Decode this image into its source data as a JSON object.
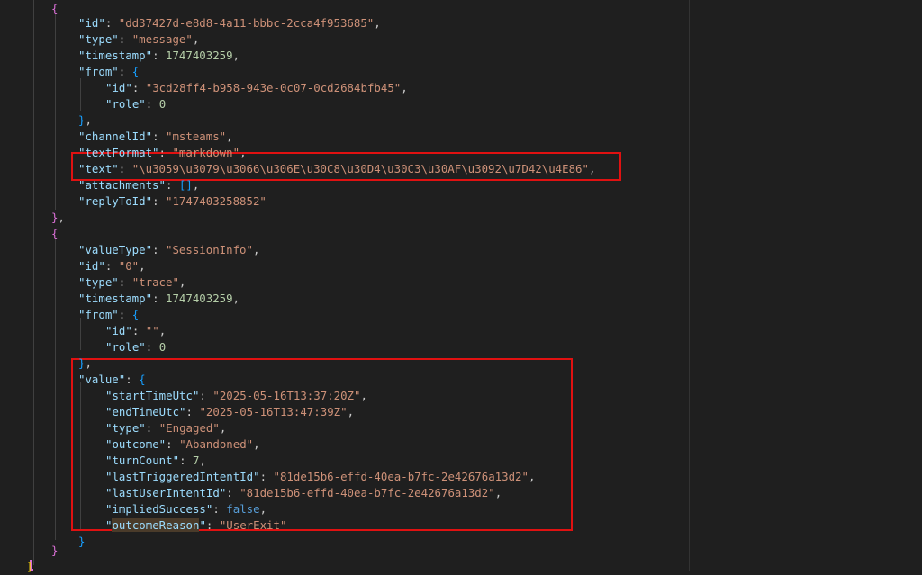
{
  "lines": [
    [
      {
        "t": "b2",
        "v": "{"
      }
    ],
    [
      {
        "t": "k",
        "v": "\"id\""
      },
      {
        "t": "p",
        "v": ": "
      },
      {
        "t": "s",
        "v": "\"dd37427d-e8d8-4a11-bbbc-2cca4f953685\""
      },
      {
        "t": "p",
        "v": ","
      }
    ],
    [
      {
        "t": "k",
        "v": "\"type\""
      },
      {
        "t": "p",
        "v": ": "
      },
      {
        "t": "s",
        "v": "\"message\""
      },
      {
        "t": "p",
        "v": ","
      }
    ],
    [
      {
        "t": "k",
        "v": "\"timestamp\""
      },
      {
        "t": "p",
        "v": ": "
      },
      {
        "t": "n",
        "v": "1747403259"
      },
      {
        "t": "p",
        "v": ","
      }
    ],
    [
      {
        "t": "k",
        "v": "\"from\""
      },
      {
        "t": "p",
        "v": ": "
      },
      {
        "t": "b3",
        "v": "{"
      }
    ],
    [
      {
        "t": "k",
        "v": "\"id\""
      },
      {
        "t": "p",
        "v": ": "
      },
      {
        "t": "s",
        "v": "\"3cd28ff4-b958-943e-0c07-0cd2684bfb45\""
      },
      {
        "t": "p",
        "v": ","
      }
    ],
    [
      {
        "t": "k",
        "v": "\"role\""
      },
      {
        "t": "p",
        "v": ": "
      },
      {
        "t": "n",
        "v": "0"
      }
    ],
    [
      {
        "t": "b3",
        "v": "}"
      },
      {
        "t": "p",
        "v": ","
      }
    ],
    [
      {
        "t": "k",
        "v": "\"channelId\""
      },
      {
        "t": "p",
        "v": ": "
      },
      {
        "t": "s",
        "v": "\"msteams\""
      },
      {
        "t": "p",
        "v": ","
      }
    ],
    [
      {
        "t": "k",
        "v": "\"textFormat\""
      },
      {
        "t": "p",
        "v": ": "
      },
      {
        "t": "s",
        "v": "\"markdown\""
      },
      {
        "t": "p",
        "v": ","
      }
    ],
    [
      {
        "t": "k",
        "v": "\"text\""
      },
      {
        "t": "p",
        "v": ": "
      },
      {
        "t": "s",
        "v": "\"\\u3059\\u3079\\u3066\\u306E\\u30C8\\u30D4\\u30C3\\u30AF\\u3092\\u7D42\\u4E86\""
      },
      {
        "t": "p",
        "v": ","
      }
    ],
    [
      {
        "t": "k",
        "v": "\"attachments\""
      },
      {
        "t": "p",
        "v": ": "
      },
      {
        "t": "b3",
        "v": "[]"
      },
      {
        "t": "p",
        "v": ","
      }
    ],
    [
      {
        "t": "k",
        "v": "\"replyToId\""
      },
      {
        "t": "p",
        "v": ": "
      },
      {
        "t": "s",
        "v": "\"1747403258852\""
      }
    ],
    [
      {
        "t": "b2",
        "v": "}"
      },
      {
        "t": "p",
        "v": ","
      }
    ],
    [
      {
        "t": "b2",
        "v": "{"
      }
    ],
    [
      {
        "t": "k",
        "v": "\"valueType\""
      },
      {
        "t": "p",
        "v": ": "
      },
      {
        "t": "s",
        "v": "\"SessionInfo\""
      },
      {
        "t": "p",
        "v": ","
      }
    ],
    [
      {
        "t": "k",
        "v": "\"id\""
      },
      {
        "t": "p",
        "v": ": "
      },
      {
        "t": "s",
        "v": "\"0\""
      },
      {
        "t": "p",
        "v": ","
      }
    ],
    [
      {
        "t": "k",
        "v": "\"type\""
      },
      {
        "t": "p",
        "v": ": "
      },
      {
        "t": "s",
        "v": "\"trace\""
      },
      {
        "t": "p",
        "v": ","
      }
    ],
    [
      {
        "t": "k",
        "v": "\"timestamp\""
      },
      {
        "t": "p",
        "v": ": "
      },
      {
        "t": "n",
        "v": "1747403259"
      },
      {
        "t": "p",
        "v": ","
      }
    ],
    [
      {
        "t": "k",
        "v": "\"from\""
      },
      {
        "t": "p",
        "v": ": "
      },
      {
        "t": "b3",
        "v": "{"
      }
    ],
    [
      {
        "t": "k",
        "v": "\"id\""
      },
      {
        "t": "p",
        "v": ": "
      },
      {
        "t": "s",
        "v": "\"\""
      },
      {
        "t": "p",
        "v": ","
      }
    ],
    [
      {
        "t": "k",
        "v": "\"role\""
      },
      {
        "t": "p",
        "v": ": "
      },
      {
        "t": "n",
        "v": "0"
      }
    ],
    [
      {
        "t": "b3",
        "v": "}"
      },
      {
        "t": "p",
        "v": ","
      }
    ],
    [
      {
        "t": "k",
        "v": "\"value\""
      },
      {
        "t": "p",
        "v": ": "
      },
      {
        "t": "b3",
        "v": "{"
      }
    ],
    [
      {
        "t": "k",
        "v": "\"startTimeUtc\""
      },
      {
        "t": "p",
        "v": ": "
      },
      {
        "t": "s",
        "v": "\"2025-05-16T13:37:20Z\""
      },
      {
        "t": "p",
        "v": ","
      }
    ],
    [
      {
        "t": "k",
        "v": "\"endTimeUtc\""
      },
      {
        "t": "p",
        "v": ": "
      },
      {
        "t": "s",
        "v": "\"2025-05-16T13:47:39Z\""
      },
      {
        "t": "p",
        "v": ","
      }
    ],
    [
      {
        "t": "k",
        "v": "\"type\""
      },
      {
        "t": "p",
        "v": ": "
      },
      {
        "t": "s",
        "v": "\"Engaged\""
      },
      {
        "t": "p",
        "v": ","
      }
    ],
    [
      {
        "t": "k",
        "v": "\"outcome\""
      },
      {
        "t": "p",
        "v": ": "
      },
      {
        "t": "s",
        "v": "\"Abandoned\""
      },
      {
        "t": "p",
        "v": ","
      }
    ],
    [
      {
        "t": "k",
        "v": "\"turnCount\""
      },
      {
        "t": "p",
        "v": ": "
      },
      {
        "t": "n",
        "v": "7"
      },
      {
        "t": "p",
        "v": ","
      }
    ],
    [
      {
        "t": "k",
        "v": "\"lastTriggeredIntentId\""
      },
      {
        "t": "p",
        "v": ": "
      },
      {
        "t": "s",
        "v": "\"81de15b6-effd-40ea-b7fc-2e42676a13d2\""
      },
      {
        "t": "p",
        "v": ","
      }
    ],
    [
      {
        "t": "k",
        "v": "\"lastUserIntentId\""
      },
      {
        "t": "p",
        "v": ": "
      },
      {
        "t": "s",
        "v": "\"81de15b6-effd-40ea-b7fc-2e42676a13d2\""
      },
      {
        "t": "p",
        "v": ","
      }
    ],
    [
      {
        "t": "k",
        "v": "\"impliedSuccess\""
      },
      {
        "t": "p",
        "v": ": "
      },
      {
        "t": "kw",
        "v": "false"
      },
      {
        "t": "p",
        "v": ","
      }
    ],
    [
      {
        "t": "k",
        "v": "\""
      },
      {
        "t": "k hl",
        "v": "outcomeReason"
      },
      {
        "t": "k",
        "v": "\""
      },
      {
        "t": "p",
        "v": ": "
      },
      {
        "t": "s",
        "v": "\"UserExit\""
      }
    ],
    [
      {
        "t": "b3",
        "v": "}"
      }
    ],
    [
      {
        "t": "b2",
        "v": "}"
      }
    ],
    [
      {
        "t": "b1",
        "v": "]"
      }
    ]
  ]
}
